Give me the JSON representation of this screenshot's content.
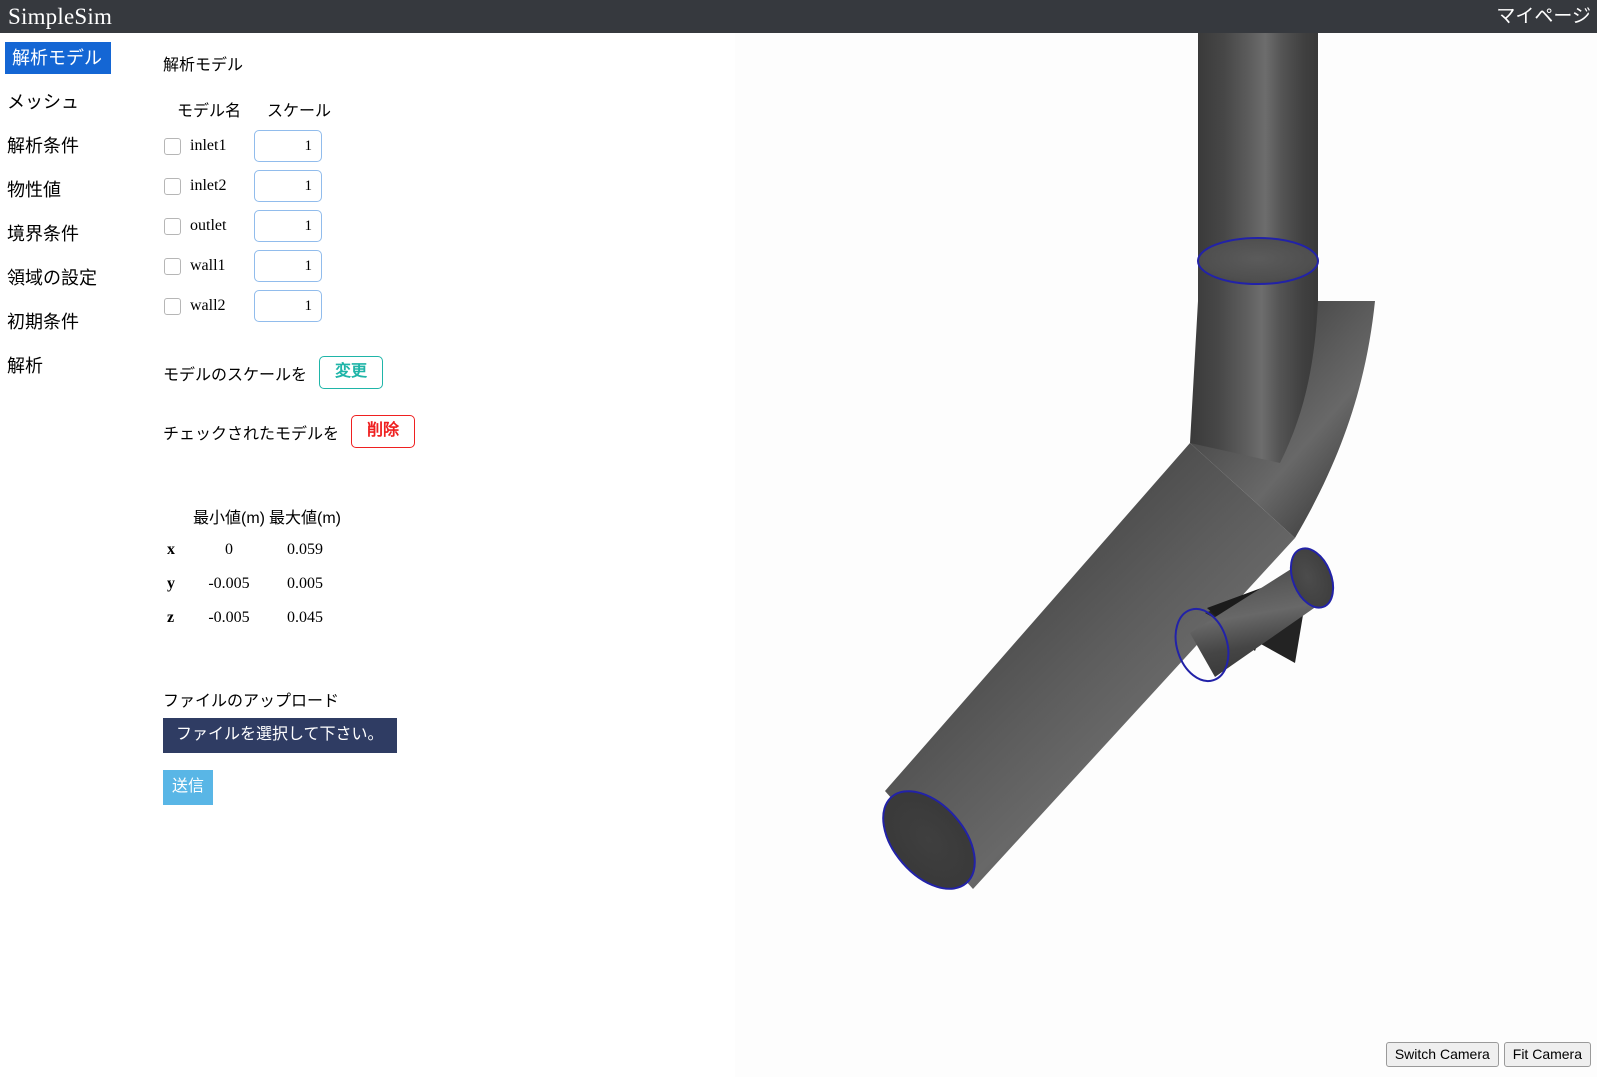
{
  "header": {
    "brand": "SimpleSim",
    "mypage": "マイページ"
  },
  "sidebar": {
    "items": [
      {
        "label": "解析モデル",
        "active": true
      },
      {
        "label": "メッシュ",
        "active": false
      },
      {
        "label": "解析条件",
        "active": false
      },
      {
        "label": "物性値",
        "active": false
      },
      {
        "label": "境界条件",
        "active": false
      },
      {
        "label": "領域の設定",
        "active": false
      },
      {
        "label": "初期条件",
        "active": false
      },
      {
        "label": "解析",
        "active": false
      }
    ]
  },
  "main": {
    "page_title": "解析モデル",
    "model_table": {
      "headers": {
        "name": "モデル名",
        "scale": "スケール"
      },
      "rows": [
        {
          "name": "inlet1",
          "scale": "1",
          "checked": false
        },
        {
          "name": "inlet2",
          "scale": "1",
          "checked": false
        },
        {
          "name": "outlet",
          "scale": "1",
          "checked": false
        },
        {
          "name": "wall1",
          "scale": "1",
          "checked": false
        },
        {
          "name": "wall2",
          "scale": "1",
          "checked": false
        }
      ]
    },
    "actions": {
      "scale_label": "モデルのスケールを",
      "scale_button": "変更",
      "delete_label": "チェックされたモデルを",
      "delete_button": "削除"
    },
    "bounds": {
      "headers": {
        "min": "最小値(m)",
        "max": "最大値(m)"
      },
      "rows": [
        {
          "axis": "x",
          "min": "0",
          "max": "0.059"
        },
        {
          "axis": "y",
          "min": "-0.005",
          "max": "0.005"
        },
        {
          "axis": "z",
          "min": "-0.005",
          "max": "0.045"
        }
      ]
    },
    "upload": {
      "label": "ファイルのアップロード",
      "file_button": "ファイルを選択して下さい。",
      "submit_button": "送信"
    }
  },
  "viewport": {
    "camera_buttons": {
      "switch": "Switch Camera",
      "fit": "Fit Camera"
    },
    "model": {
      "description": "3D pipe junction geometry",
      "surface_color": "#484848",
      "outline_color": "#2222a8",
      "background_color": "#fdfdfd"
    }
  },
  "colors": {
    "header_bg": "#36393e",
    "accent_blue": "#1466d4",
    "teal": "#1fb5a8",
    "red": "#ef2020",
    "navy": "#2f3c63",
    "light_blue": "#59b6e6",
    "input_border": "#91bcec"
  }
}
